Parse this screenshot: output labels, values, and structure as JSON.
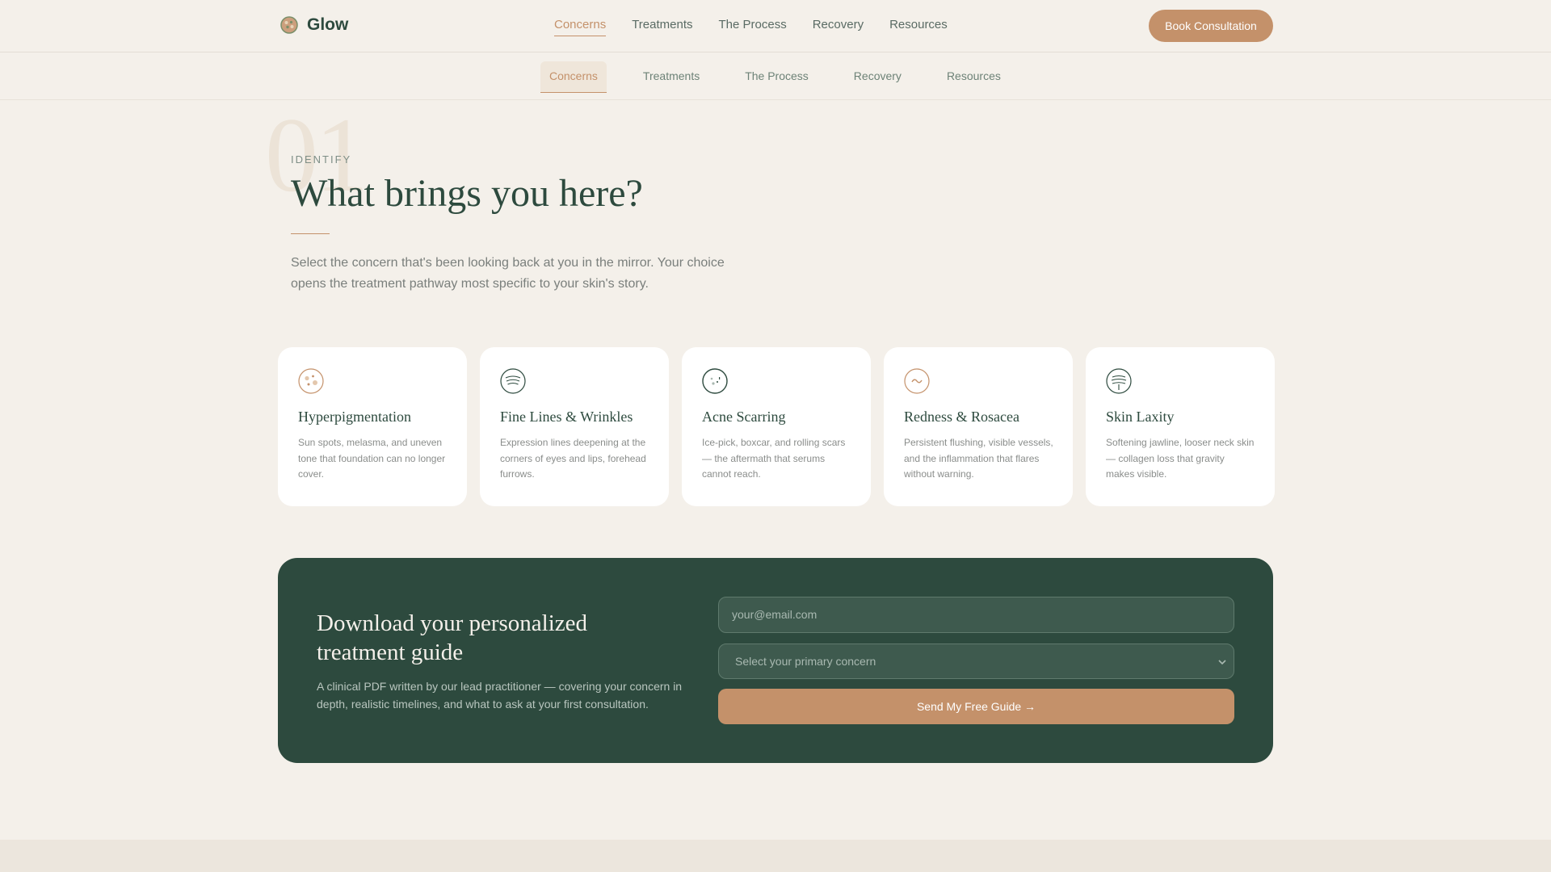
{
  "header": {
    "brand": "Glow",
    "nav": [
      "Concerns",
      "Treatments",
      "The Process",
      "Recovery",
      "Resources"
    ],
    "active_nav": "Concerns",
    "cta_label": "Book Consultation"
  },
  "subnav": {
    "items": [
      "Concerns",
      "Treatments",
      "The Process",
      "Recovery",
      "Resources"
    ],
    "active": "Concerns"
  },
  "hero": {
    "section_number": "01",
    "eyebrow": "IDENTIFY",
    "title": "What brings you here?",
    "description": "Select the concern that's been looking back at you in the mirror. Your choice opens the treatment pathway most specific to your skin's story."
  },
  "concerns": [
    {
      "title": "Hyperpigmentation",
      "description": "Sun spots, melasma, and uneven tone that foundation can no longer cover.",
      "icon": "pigment-spots-icon"
    },
    {
      "title": "Fine Lines & Wrinkles",
      "description": "Expression lines deepening at the corners of eyes and lips, forehead furrows.",
      "icon": "wrinkle-lines-icon"
    },
    {
      "title": "Acne Scarring",
      "description": "Ice-pick, boxcar, and rolling scars — the aftermath that serums cannot reach.",
      "icon": "acne-scar-icon"
    },
    {
      "title": "Redness & Rosacea",
      "description": "Persistent flushing, visible vessels, and the inflammation that flares without warning.",
      "icon": "redness-wave-icon"
    },
    {
      "title": "Skin Laxity",
      "description": "Softening jawline, looser neck skin — collagen loss that gravity makes visible.",
      "icon": "laxity-lines-icon"
    }
  ],
  "guide": {
    "title": "Download your personalized treatment guide",
    "description": "A clinical PDF written by our lead practitioner — covering your concern in depth, realistic timelines, and what to ask at your first consultation.",
    "email_placeholder": "your@email.com",
    "select_placeholder": "Select your primary concern",
    "submit_label": "Send My Free Guide →"
  },
  "colors": {
    "background": "#f4f0ea",
    "primary_green": "#2d4a3e",
    "accent_copper": "#c4916a",
    "card": "#ffffff"
  }
}
